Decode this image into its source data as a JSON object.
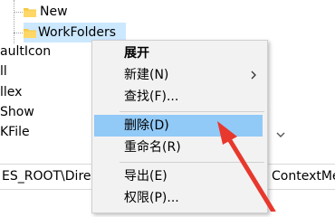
{
  "tree": {
    "nodes": [
      {
        "label": "New"
      },
      {
        "label": "WorkFolders"
      },
      {
        "label": "aultIcon"
      },
      {
        "label": "ll"
      },
      {
        "label": "llex"
      },
      {
        "label": "Show"
      },
      {
        "label": "KFile"
      }
    ]
  },
  "statusbar": {
    "path_left": "ES_ROOT\\Dire",
    "path_right": "ContextMe"
  },
  "context_menu": {
    "items": [
      {
        "label": "展开",
        "bold": true
      },
      {
        "label": "新建(N)",
        "submenu": true
      },
      {
        "label": "查找(F)..."
      },
      {
        "label": "删除(D)",
        "highlighted": true
      },
      {
        "label": "重命名(R)"
      },
      {
        "label": "导出(E)"
      },
      {
        "label": "权限(P)..."
      }
    ]
  },
  "colors": {
    "menu_bg": "#f2f2f2",
    "menu_highlight": "#91c9f7",
    "tree_selection": "#cce8ff",
    "folder": "#f6c843",
    "annotation_arrow": "#e8382d"
  },
  "icons": [
    "folder-icon",
    "chevron-right-icon",
    "chevron-down-icon",
    "red-arrow-annotation"
  ]
}
